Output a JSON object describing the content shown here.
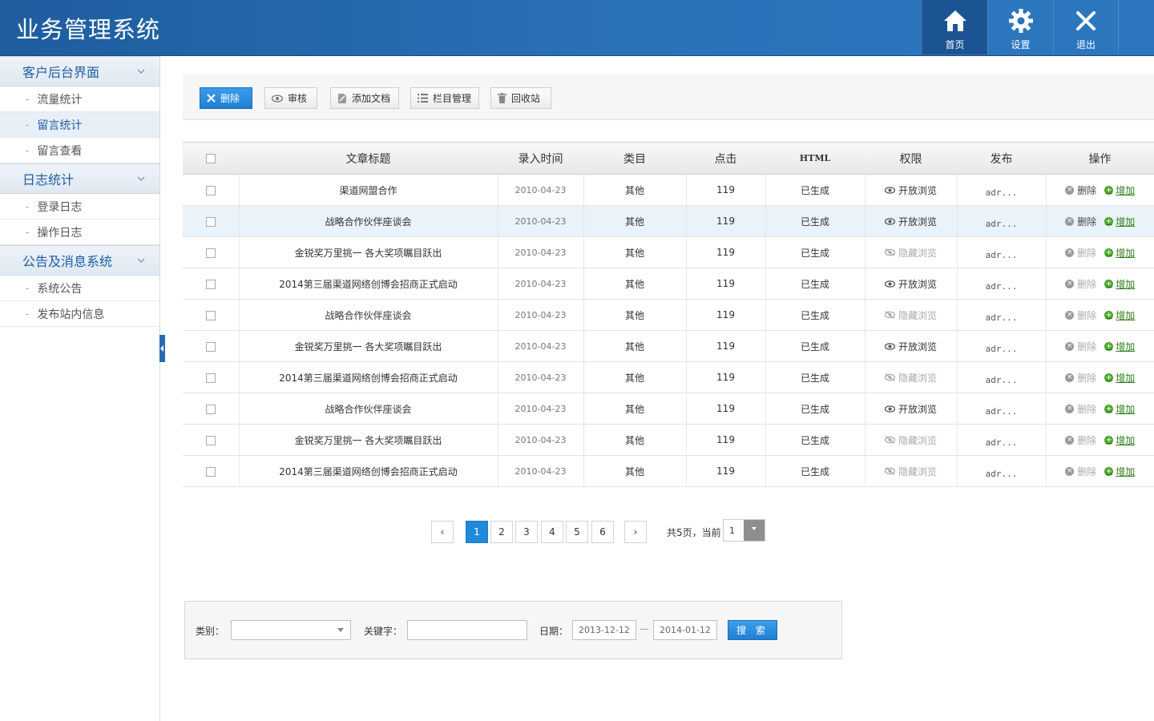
{
  "app": {
    "title": "业务管理系统"
  },
  "top_nav": [
    {
      "label": "首页",
      "icon": "home-icon",
      "active": true
    },
    {
      "label": "设置",
      "icon": "gear-icon",
      "active": false
    },
    {
      "label": "退出",
      "icon": "close-icon",
      "active": false
    }
  ],
  "sidebar": {
    "groups": [
      {
        "title": "客户后台界面",
        "items": [
          {
            "label": "流量统计"
          },
          {
            "label": "留言统计",
            "active": true
          },
          {
            "label": "留言查看"
          }
        ]
      },
      {
        "title": "日志统计",
        "items": [
          {
            "label": "登录日志"
          },
          {
            "label": "操作日志"
          }
        ]
      },
      {
        "title": "公告及消息系统",
        "items": [
          {
            "label": "系统公告"
          },
          {
            "label": "发布站内信息"
          }
        ]
      }
    ],
    "item_dash": "-"
  },
  "toolbar": {
    "delete": "删除",
    "audit": "审核",
    "add_doc": "添加文档",
    "column_manage": "栏目管理",
    "recycle": "回收站"
  },
  "table": {
    "headers": [
      "文章标题",
      "录入时间",
      "类目",
      "点击",
      "HTML",
      "权限",
      "发布",
      "操作"
    ],
    "op_delete": "删除",
    "op_add": "增加",
    "rows": [
      {
        "title": "渠道网盟合作",
        "date": "2010-04-23",
        "category": "其他",
        "clicks": "119",
        "html": "已生成",
        "perm": "开放浏览",
        "perm_open": true,
        "publish": "adr...",
        "highlight": false
      },
      {
        "title": "战略合作伙伴座谈会",
        "date": "2010-04-23",
        "category": "其他",
        "clicks": "119",
        "html": "已生成",
        "perm": "开放浏览",
        "perm_open": true,
        "publish": "adr...",
        "highlight": true
      },
      {
        "title": "金锐奖万里挑一 各大奖项瞩目跃出",
        "date": "2010-04-23",
        "category": "其他",
        "clicks": "119",
        "html": "已生成",
        "perm": "隐藏浏览",
        "perm_open": false,
        "publish": "adr...",
        "highlight": false
      },
      {
        "title": "2014第三届渠道网络创博会招商正式启动",
        "date": "2010-04-23",
        "category": "其他",
        "clicks": "119",
        "html": "已生成",
        "perm": "开放浏览",
        "perm_open": true,
        "publish": "adr...",
        "highlight": false
      },
      {
        "title": "战略合作伙伴座谈会",
        "date": "2010-04-23",
        "category": "其他",
        "clicks": "119",
        "html": "已生成",
        "perm": "隐藏浏览",
        "perm_open": false,
        "publish": "adr...",
        "highlight": false
      },
      {
        "title": "金锐奖万里挑一 各大奖项瞩目跃出",
        "date": "2010-04-23",
        "category": "其他",
        "clicks": "119",
        "html": "已生成",
        "perm": "开放浏览",
        "perm_open": true,
        "publish": "adr...",
        "highlight": false
      },
      {
        "title": "2014第三届渠道网络创博会招商正式启动",
        "date": "2010-04-23",
        "category": "其他",
        "clicks": "119",
        "html": "已生成",
        "perm": "隐藏浏览",
        "perm_open": false,
        "publish": "adr...",
        "highlight": false
      },
      {
        "title": "战略合作伙伴座谈会",
        "date": "2010-04-23",
        "category": "其他",
        "clicks": "119",
        "html": "已生成",
        "perm": "开放浏览",
        "perm_open": true,
        "publish": "adr...",
        "highlight": false
      },
      {
        "title": "金锐奖万里挑一 各大奖项瞩目跃出",
        "date": "2010-04-23",
        "category": "其他",
        "clicks": "119",
        "html": "已生成",
        "perm": "隐藏浏览",
        "perm_open": false,
        "publish": "adr...",
        "highlight": false
      },
      {
        "title": "2014第三届渠道网络创博会招商正式启动",
        "date": "2010-04-23",
        "category": "其他",
        "clicks": "119",
        "html": "已生成",
        "perm": "隐藏浏览",
        "perm_open": false,
        "publish": "adr...",
        "highlight": false
      }
    ]
  },
  "pagination": {
    "prev": "‹",
    "next": "›",
    "pages": [
      "1",
      "2",
      "3",
      "4",
      "5",
      "6"
    ],
    "current": "1",
    "info": "共5页，当前",
    "jump_value": "1"
  },
  "search": {
    "category_label": "类别：",
    "category_value": "",
    "keyword_label": "关键字：",
    "keyword_value": "",
    "date_label": "日期：",
    "date_from": "2013-12-12",
    "date_sep": "—",
    "date_to": "2014-01-12",
    "button": "搜 索"
  },
  "colors": {
    "header_bg": "#2a72b8",
    "primary_button": "#1f8ad8",
    "link_green": "#2f7d1b"
  }
}
